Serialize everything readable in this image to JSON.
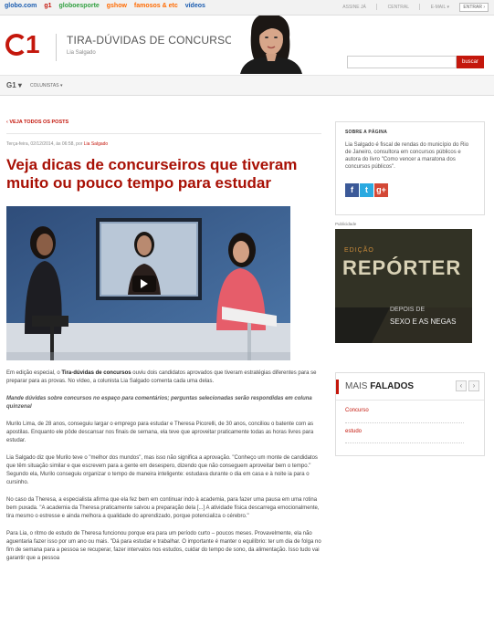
{
  "globobar": {
    "links": [
      "globo.com",
      "g1",
      "globoesporte",
      "gshow",
      "famosos & etc",
      "vídeos"
    ],
    "assine": "ASSINE JÁ",
    "central": "CENTRAL",
    "email": "E-MAIL ▾",
    "entrar": "ENTRAR ›"
  },
  "header": {
    "logo": "G1",
    "blog_title": "TIRA-DÚVIDAS DE CONCURSOS",
    "author": "Lia Salgado",
    "search_button": "buscar",
    "search_placeholder": ""
  },
  "nav": {
    "g1": "G1 ▾",
    "colunistas": "COLUNISTAS ▾"
  },
  "article": {
    "back": "‹ VEJA TODOS OS POSTS",
    "date": "Terça-feira, 02/12/2014, às 06:58, por ",
    "date_author": "Lia Salgado",
    "title": "Veja dicas de concurseiros que tiveram muito ou pouco tempo para estudar",
    "p1_pre": "Em edição especial, o ",
    "p1_bold": "Tira-dúvidas de concursos",
    "p1_post": " ouviu dois candidatos aprovados que tiveram estratégias diferentes para se preparar para as provas. No vídeo, a colunista Lia Salgado comenta cada uma delas.",
    "p2": "Mande dúvidas sobre concursos no espaço para comentários; perguntas selecionadas serão respondidas em coluna quinzenal",
    "p3": "Murilo Lima, de 28 anos, conseguiu largar o emprego para estudar e Theresa Picorelli, de 30 anos, conciliou o batente com as apostilas. Enquanto ele pôde descansar nos finais de semana, ela teve que aproveitar praticamente todas as horas livres para estudar.",
    "p4": "Lia Salgado diz que Murilo teve o \"melhor dos mundos\", mas isso não significa a aprovação. \"Conheço um monte de candidatos que têm situação similar e que escrevem para a gente em desespero, dizendo que não conseguem aproveitar bem o tempo.\" Segundo ela, Murilo conseguiu organizar o tempo de maneira inteligente: estudava durante o dia em casa e à noite ia para o cursinho.",
    "p5": "No caso da Theresa, a especialista afirma que ela fez bem em continuar indo à academia, para fazer uma pausa em uma rotina bem puxada. \"A academia da Theresa praticamente salvou a preparação dela [...] A atividade física descarrega emocionalmente, tira mesmo o estresse e ainda melhora a qualidade do aprendizado, porque potencializa o cérebro.\"",
    "p6": "Para Lia, o ritmo de estudo de Theresa funcionou porque era para um período curto – poucos meses. Provavelmente, ela não aguentaria fazer isso por um ano ou mais. \"Dá para estudar e trabalhar. O importante é manter o equilíbrio: ter um dia de folga no fim de semana para a pessoa se recuperar, fazer intervalos nos estudos, cuidar do tempo de sono, da alimentação. Isso tudo vai garantir que a pessoa"
  },
  "sidebar": {
    "sobre_label": "SOBRE A PÁGINA",
    "sobre_text": "Lia Salgado é fiscal de rendas do município do Rio de Janeiro, consultora em concursos públicos e autora do livro \"Como vencer a maratona dos concursos públicos\".",
    "social": [
      "f",
      "t",
      "g+"
    ],
    "publicidade": "Publicidade",
    "ad": {
      "edicao": "EDIÇÃO",
      "reporter": "REPÓRTER",
      "depois": "DEPOIS DE",
      "sexo": "SEXO E AS NEGAS"
    },
    "mais_falados_pre": "MAIS ",
    "mais_falados_bold": "FALADOS",
    "mais_items": [
      "Concurso",
      "estudo"
    ]
  },
  "colors": {
    "brand_red": "#c4170c",
    "title_red": "#a81005"
  }
}
